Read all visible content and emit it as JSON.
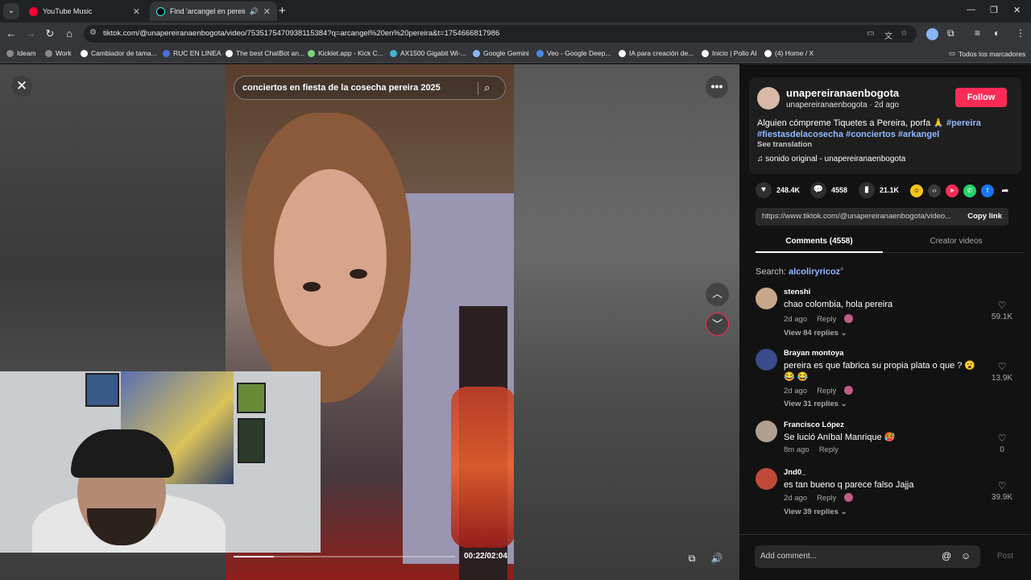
{
  "browser": {
    "tabs": [
      {
        "title": "YouTube Music",
        "favicon_color": "#ff0033",
        "active": false
      },
      {
        "title": "Find 'arcangel en pereira' o",
        "favicon_color": "#000000",
        "active": true
      }
    ],
    "new_tab": "+",
    "url": "tiktok.com/@unapereiranaenbogota/video/7535175470938115384?q=arcangel%20en%20pereira&t=1754666817986",
    "bookmarks": [
      {
        "label": "Ideam",
        "color": "#8a8a8a"
      },
      {
        "label": "Work",
        "color": "#8a8a8a"
      },
      {
        "label": "Cambiador de tama...",
        "color": "#ffffff"
      },
      {
        "label": "RUC EN LINEA",
        "color": "#4a6fe0"
      },
      {
        "label": "The best ChatBot an...",
        "color": "#ffffff"
      },
      {
        "label": "Kicklet.app - Kick C...",
        "color": "#7ad67a"
      },
      {
        "label": "AX1500 Gigabit Wi-...",
        "color": "#4ab0d0"
      },
      {
        "label": "Google Gemini",
        "color": "#8ab4f8"
      },
      {
        "label": "Veo - Google Deep...",
        "color": "#4a8ae0"
      },
      {
        "label": "IA para creación de...",
        "color": "#ffffff"
      },
      {
        "label": "Inicio | Pollo AI",
        "color": "#ffffff"
      },
      {
        "label": "(4) Home / X",
        "color": "#ffffff"
      }
    ],
    "all_bookmarks": "Todos los marcadores"
  },
  "player": {
    "search_query": "conciertos en fiesta de la cosecha pereira 2025",
    "time": "00:22/02:04",
    "progress": 0.18,
    "close_icon": "close-icon",
    "more_icon": "more-icon"
  },
  "creator": {
    "username": "unapereiranaenbogota",
    "sub": "unapereiranaenbogota · 2d ago",
    "follow": "Follow",
    "desc_text": "Alguien cómpreme Tiquetes a Pereira, porfa 🙏",
    "tags": [
      "#pereira",
      "#fiestasdelacosecha",
      "#conciertos",
      "#arkangel"
    ],
    "see_translation": "See translation",
    "sound": "sonido original - unapereiranaenbogota"
  },
  "stats": {
    "likes": "248.4K",
    "comments": "4558",
    "saves": "21.1K"
  },
  "share_colors": [
    "#f5c518",
    "#3a3a3a",
    "#fe2c55",
    "#25d366",
    "#1877f2",
    "#2f2f2f"
  ],
  "link": {
    "url": "https://www.tiktok.com/@unapereiranaenbogota/video...",
    "copy": "Copy link"
  },
  "tabs": {
    "comments": "Comments (4558)",
    "creator_videos": "Creator videos"
  },
  "search_suggest": {
    "prefix": "Search: ",
    "keyword": "alcoliryricoz"
  },
  "comments": [
    {
      "user": "stenshi",
      "text": "chao colombia, hola pereira",
      "time": "2d ago",
      "reply": "Reply",
      "likes": "59.1K",
      "view": "View 84 replies",
      "avatar_color": "#c8a88a",
      "has_mini": true
    },
    {
      "user": "Brayan montoya",
      "text": "pereira es que fabrica su propia plata o que ? 😮 😂 😂",
      "time": "2d ago",
      "reply": "Reply",
      "likes": "13.9K",
      "view": "View 31 replies",
      "avatar_color": "#3a4a8a",
      "has_mini": true
    },
    {
      "user": "Francisco López",
      "text": "Se lució Aníbal Manrique 🥵",
      "time": "8m ago",
      "reply": "Reply",
      "likes": "0",
      "view": "",
      "avatar_color": "#b0a090",
      "has_mini": false
    },
    {
      "user": "Jnd0_",
      "text": "es tan bueno q parece falso Jajja",
      "time": "2d ago",
      "reply": "Reply",
      "likes": "39.9K",
      "view": "View 39 replies",
      "avatar_color": "#c04a3a",
      "has_mini": true
    }
  ],
  "add_comment": {
    "placeholder": "Add comment...",
    "post": "Post"
  }
}
